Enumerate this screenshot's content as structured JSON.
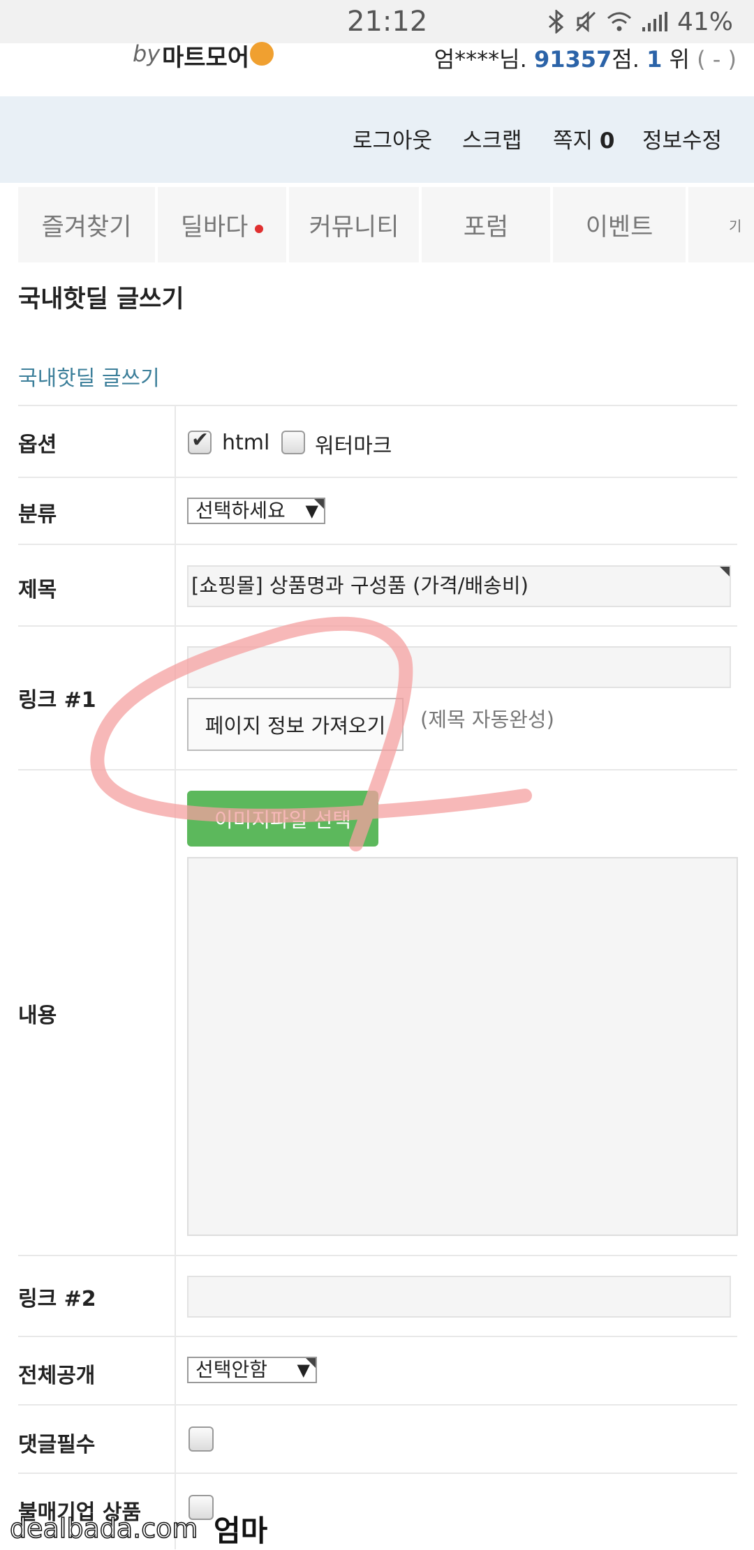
{
  "status_bar": {
    "time": "21:12",
    "battery": "41%",
    "icons": [
      "bluetooth-icon",
      "mute-icon",
      "wifi-icon",
      "signal-icon"
    ]
  },
  "header": {
    "by": "by",
    "brand": "마트모어",
    "user_name": "엄****님.",
    "points": "91357",
    "points_suffix": "점.",
    "rank": "1",
    "rank_suffix": "위",
    "rank_change": "( - )"
  },
  "actions": {
    "logout": "로그아웃",
    "scrap": "스크랩",
    "messages": "쪽지",
    "messages_count": "0",
    "edit_info": "정보수정"
  },
  "nav_tabs": [
    "즐겨찾기",
    "딜바다",
    "커뮤니티",
    "포럼",
    "이벤트",
    "기"
  ],
  "page_title": "국내핫딜 글쓰기",
  "section_title": "국내핫딜 글쓰기",
  "form": {
    "option_label": "옵션",
    "html_label": "html",
    "html_checked": true,
    "watermark_label": "워터마크",
    "watermark_checked": false,
    "category_label": "분류",
    "category_value": "선택하세요",
    "subject_label": "제목",
    "subject_value": "[쇼핑몰] 상품명과 구성품 (가격/배송비)",
    "link1_label": "링크 #1",
    "link1_value": "",
    "fetch_button": "페이지 정보 가져오기",
    "fetch_hint": "(제목 자동완성)",
    "content_label": "내용",
    "image_button": "이미지파일 선택",
    "content_value": "",
    "link2_label": "링크 #2",
    "link2_value": "",
    "public_label": "전체공개",
    "public_value": "선택안함",
    "comment_required_label": "댓글필수",
    "comment_required_checked": false,
    "unfair_company_label": "불매기업 상품",
    "unfair_company_checked": false
  },
  "overlay": {
    "watermark_text": "dealbada.com",
    "caption": "엄마",
    "scribble_color": "#f4a0a0"
  }
}
